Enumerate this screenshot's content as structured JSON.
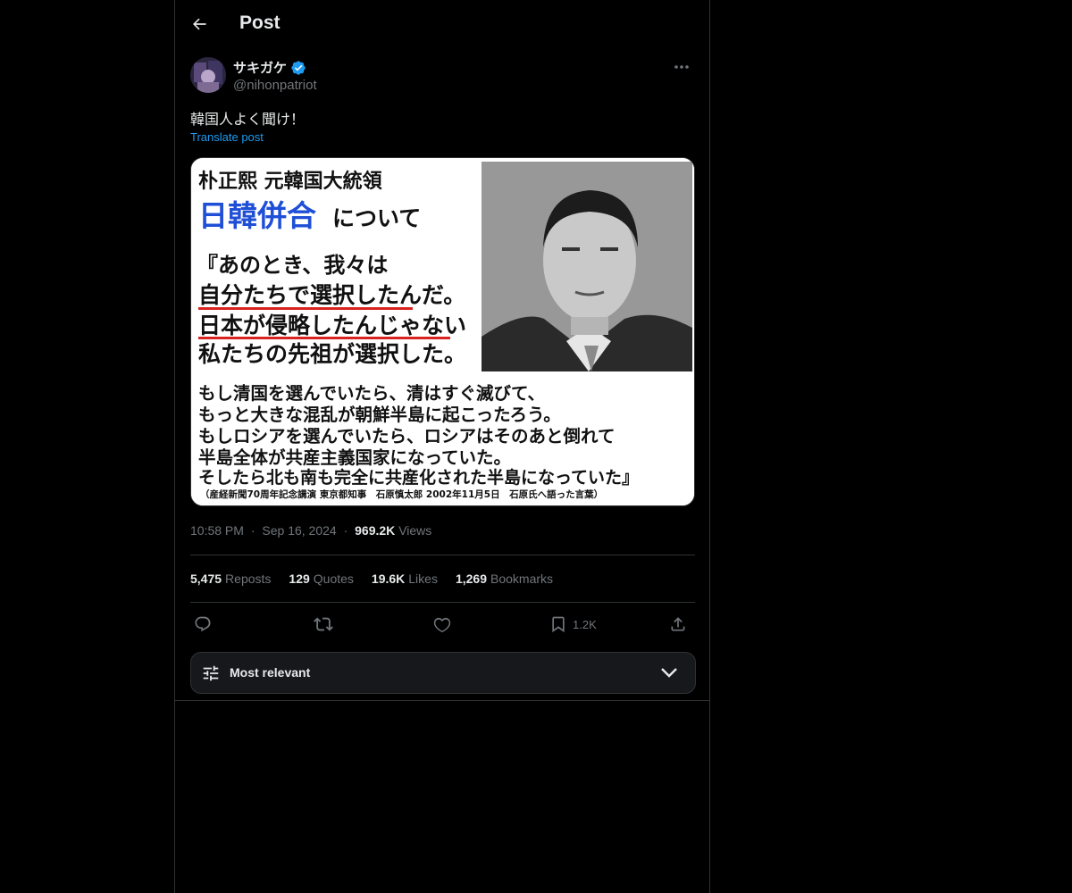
{
  "header": {
    "title": "Post"
  },
  "author": {
    "name": "サキガケ",
    "handle": "@nihonpatriot"
  },
  "post": {
    "text": "韓国人よく聞け！",
    "translate_label": "Translate post"
  },
  "image_text": {
    "line1": "朴正熙 元韓国大統領",
    "line2_blue": "日韓併合",
    "line2_rest": "について",
    "q1": "『あのとき、我々は",
    "q2": "自分たちで選択したんだ。",
    "q3": "日本が侵略したんじゃない",
    "q4": "私たちの先祖が選択した。",
    "b1": "もし清国を選んでいたら、清はすぐ滅びて、",
    "b2": "もっと大きな混乱が朝鮮半島に起こったろう。",
    "b3": "もしロシアを選んでいたら、ロシアはそのあと倒れて",
    "b4": "半島全体が共産主義国家になっていた。",
    "b5": "そしたら北も南も完全に共産化された半島になっていた』",
    "caption": "（産経新聞70周年記念講演 東京都知事　石原慎太郎 2002年11月5日　石原氏へ語った言葉）"
  },
  "meta": {
    "time": "10:58 PM",
    "sep": "·",
    "date": "Sep 16, 2024",
    "views_count": "969.2K",
    "views_label": "Views"
  },
  "stats": [
    {
      "count": "5,475",
      "label": "Reposts"
    },
    {
      "count": "129",
      "label": "Quotes"
    },
    {
      "count": "19.6K",
      "label": "Likes"
    },
    {
      "count": "1,269",
      "label": "Bookmarks"
    }
  ],
  "actions": {
    "bookmark_count": "1.2K"
  },
  "sort": {
    "label": "Most relevant"
  },
  "colors": {
    "accent": "#1d9bf0",
    "verified": "#1d9bf0",
    "image_blue": "#1f4fd6",
    "underline": "#d9231f"
  }
}
